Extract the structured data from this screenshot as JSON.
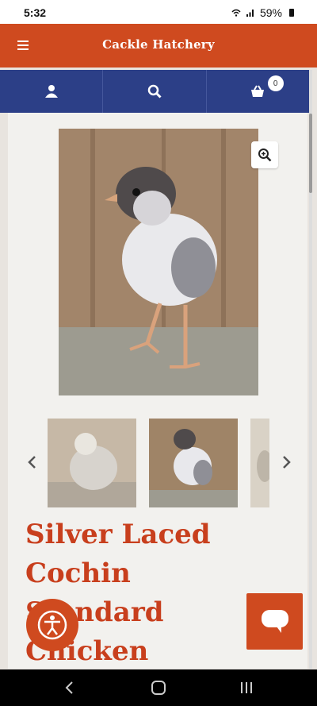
{
  "status": {
    "time": "5:32",
    "battery": "59%"
  },
  "header": {
    "title": "Cackle Hatchery",
    "menu_icon": "hamburger-icon"
  },
  "navbar": {
    "account_icon": "user-icon",
    "search_icon": "search-icon",
    "cart_icon": "basket-icon",
    "cart_count": "0"
  },
  "product": {
    "title_lines": [
      "Silver Laced",
      "Cochin",
      "Standard",
      "Chicken"
    ]
  },
  "colors": {
    "brand_orange": "#cf4a1f",
    "nav_blue": "#2c3f87",
    "title_red": "#c83f1d"
  }
}
